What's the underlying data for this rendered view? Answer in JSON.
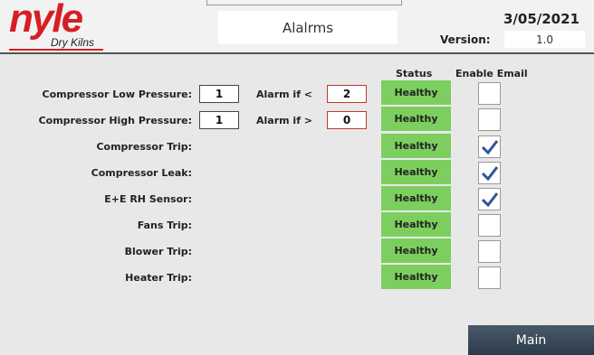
{
  "header": {
    "logo_text": "nyle",
    "logo_sub": "Dry Kilns",
    "title": "Alalrms",
    "date": "3/05/2021",
    "version_label": "Version:",
    "version_value": "1.0"
  },
  "columns": {
    "status": "Status",
    "enable_email": "Enable Email"
  },
  "rows": [
    {
      "label": "Compressor Low Pressure:",
      "value": "1",
      "cmp_label": "Alarm if <",
      "threshold": "2",
      "status": "Healthy",
      "email": false
    },
    {
      "label": "Compressor High Pressure:",
      "value": "1",
      "cmp_label": "Alarm if >",
      "threshold": "0",
      "status": "Healthy",
      "email": false
    },
    {
      "label": "Compressor Trip:",
      "status": "Healthy",
      "email": true
    },
    {
      "label": "Compressor Leak:",
      "status": "Healthy",
      "email": true
    },
    {
      "label": "E+E RH Sensor:",
      "status": "Healthy",
      "email": true
    },
    {
      "label": "Fans Trip:",
      "status": "Healthy",
      "email": false
    },
    {
      "label": "Blower Trip:",
      "status": "Healthy",
      "email": false
    },
    {
      "label": "Heater Trip:",
      "status": "Healthy",
      "email": false
    }
  ],
  "footer": {
    "main_label": "Main"
  },
  "colors": {
    "healthy": "#7ccf5e",
    "brand": "#d81e24",
    "alarm_border": "#c0392b"
  },
  "icons": {
    "checkbox_checked": "checkmark-icon"
  }
}
